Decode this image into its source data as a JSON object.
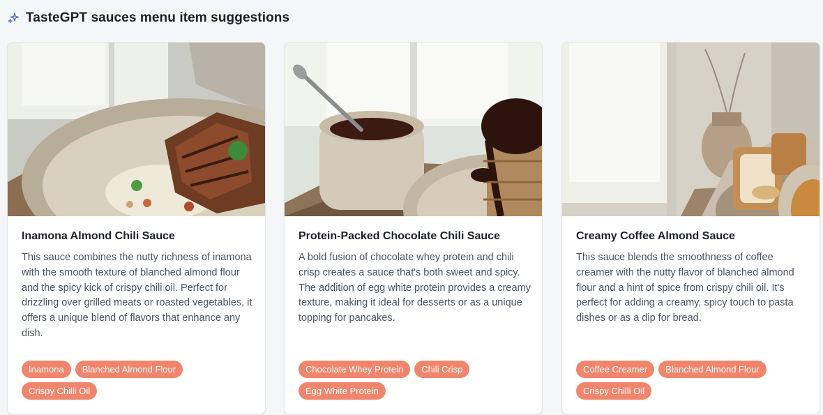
{
  "header": {
    "title": "TasteGPT sauces menu item suggestions",
    "icon": "sparkle-icon"
  },
  "cards": [
    {
      "name": "Inamona Almond Chili Sauce",
      "description": "This sauce combines the nutty richness of inamona with the smooth texture of blanched almond flour and the spicy kick of crispy chili oil. Perfect for drizzling over grilled meats or roasted vegetables, it offers a unique blend of flavors that enhance any dish.",
      "tags": [
        "Inamona",
        "Blanched Almond Flour",
        "Crispy Chilli Oil"
      ]
    },
    {
      "name": "Protein-Packed Chocolate Chili Sauce",
      "description": "A bold fusion of chocolate whey protein and chili crisp creates a sauce that's both sweet and spicy. The addition of egg white protein provides a creamy texture, making it ideal for desserts or as a unique topping for pancakes.",
      "tags": [
        "Chocolate Whey Protein",
        "Chili Crisp",
        "Egg White Protein"
      ]
    },
    {
      "name": "Creamy Coffee Almond Sauce",
      "description": "This sauce blends the smoothness of coffee creamer with the nutty flavor of blanched almond flour and a hint of spice from crispy chili oil. It's perfect for adding a creamy, spicy touch to pasta dishes or as a dip for bread.",
      "tags": [
        "Coffee Creamer",
        "Blanched Almond Flour",
        "Crispy Chilli Oil"
      ]
    }
  ],
  "colors": {
    "tag_bg": "#f0856d",
    "accent_icon": "#4a63d8",
    "page_bg": "#f5f6f8"
  }
}
